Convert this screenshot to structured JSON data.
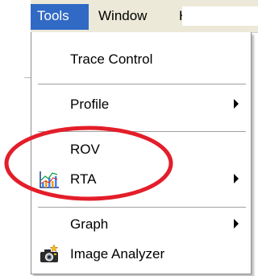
{
  "menubar": {
    "items": [
      {
        "label": "Tools",
        "active": true
      },
      {
        "label": "Window",
        "active": false
      },
      {
        "label": "H",
        "active": false
      }
    ]
  },
  "menu": {
    "items": [
      {
        "label": "Trace Control",
        "submenu": false,
        "icon": ""
      },
      {
        "label": "Profile",
        "submenu": true,
        "icon": ""
      },
      {
        "label": "ROV",
        "submenu": false,
        "icon": ""
      },
      {
        "label": "RTA",
        "submenu": true,
        "icon": "chart-icon"
      },
      {
        "label": "Graph",
        "submenu": true,
        "icon": ""
      },
      {
        "label": "Image Analyzer",
        "submenu": false,
        "icon": "camera-icon"
      }
    ]
  },
  "colors": {
    "menubar_bg": "#ece9d8",
    "selection": "#316ac5",
    "annotation": "#e31e2a"
  }
}
